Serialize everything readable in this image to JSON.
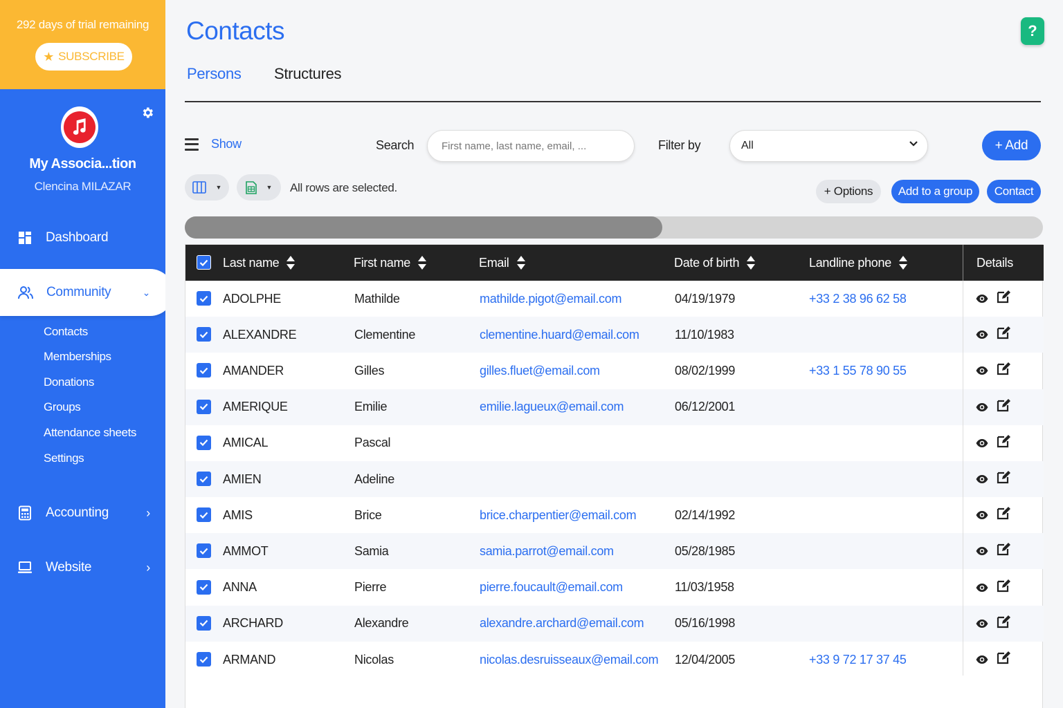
{
  "trial": {
    "text": "292 days of trial remaining",
    "subscribe_label": "SUBSCRIBE",
    "color": "#fbb833"
  },
  "organization": {
    "name": "My Associa...tion",
    "user": "Clencina MILAZAR",
    "logo_icon": "music-note-icon"
  },
  "sidebar": {
    "accent": "#2b6ef0",
    "nav": [
      {
        "label": "Dashboard",
        "icon": "dashboard-icon"
      },
      {
        "label": "Community",
        "icon": "community-icon",
        "expanded": true
      },
      {
        "label": "Accounting",
        "icon": "calculator-icon"
      },
      {
        "label": "Website",
        "icon": "laptop-icon"
      }
    ],
    "community_items": [
      "Contacts",
      "Memberships",
      "Donations",
      "Groups",
      "Attendance sheets",
      "Settings"
    ]
  },
  "page": {
    "title": "Contacts",
    "help_label": "?",
    "tabs": [
      {
        "label": "Persons",
        "active": true
      },
      {
        "label": "Structures",
        "active": false
      }
    ]
  },
  "toolbar": {
    "show_label": "Show",
    "search_label": "Search",
    "search_placeholder": "First name, last name, email, ...",
    "search_value": "",
    "filter_label": "Filter by",
    "filter_value": "All",
    "add_label": "+ Add",
    "selected_text": "All rows are selected.",
    "options_label": "+ Options",
    "add_group_label": "Add to a group",
    "contact_label": "Contact"
  },
  "table": {
    "columns": [
      "Last name",
      "First name",
      "Email",
      "Date of birth",
      "Landline phone",
      "Details"
    ],
    "rows": [
      {
        "last": "ADOLPHE",
        "first": "Mathilde",
        "email": "mathilde.pigot@email.com",
        "dob": "04/19/1979",
        "phone": "+33 2 38 96 62 58"
      },
      {
        "last": "ALEXANDRE",
        "first": "Clementine",
        "email": "clementine.huard@email.com",
        "dob": "11/10/1983",
        "phone": ""
      },
      {
        "last": "AMANDER",
        "first": "Gilles",
        "email": "gilles.fluet@email.com",
        "dob": "08/02/1999",
        "phone": "+33 1 55 78 90 55"
      },
      {
        "last": "AMERIQUE",
        "first": "Emilie",
        "email": "emilie.lagueux@email.com",
        "dob": "06/12/2001",
        "phone": ""
      },
      {
        "last": "AMICAL",
        "first": "Pascal",
        "email": "",
        "dob": "",
        "phone": ""
      },
      {
        "last": "AMIEN",
        "first": "Adeline",
        "email": "",
        "dob": "",
        "phone": ""
      },
      {
        "last": "AMIS",
        "first": "Brice",
        "email": "brice.charpentier@email.com",
        "dob": "02/14/1992",
        "phone": ""
      },
      {
        "last": "AMMOT",
        "first": "Samia",
        "email": "samia.parrot@email.com",
        "dob": "05/28/1985",
        "phone": ""
      },
      {
        "last": "ANNA",
        "first": "Pierre",
        "email": "pierre.foucault@email.com",
        "dob": "11/03/1958",
        "phone": ""
      },
      {
        "last": "ARCHARD",
        "first": "Alexandre",
        "email": "alexandre.archard@email.com",
        "dob": "05/16/1998",
        "phone": ""
      },
      {
        "last": "ARMAND",
        "first": "Nicolas",
        "email": "nicolas.desruisseaux@email.com",
        "dob": "12/04/2005",
        "phone": "+33 9 72 17 37 45"
      }
    ]
  }
}
